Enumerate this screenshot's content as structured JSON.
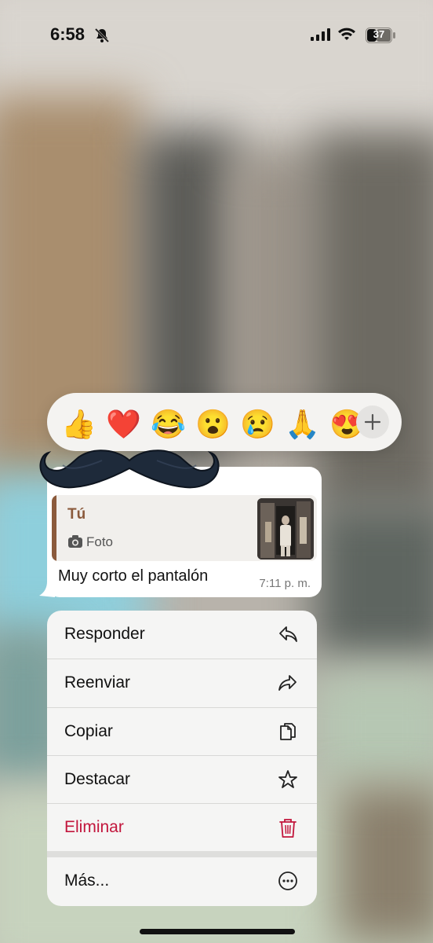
{
  "status_bar": {
    "time": "6:58",
    "battery": "37",
    "icons": [
      "bell-slash-icon",
      "signal-icon",
      "wifi-icon",
      "battery-icon"
    ]
  },
  "reactions": {
    "emojis": [
      "👍",
      "❤️",
      "😂",
      "😮",
      "😢",
      "🙏",
      "😍"
    ],
    "more_icon": "plus-icon"
  },
  "message": {
    "quote": {
      "author": "Tú",
      "kind": "Foto",
      "icon": "camera-icon"
    },
    "text": "Muy corto el pantalón",
    "time": "7:11 p. m."
  },
  "context_menu": {
    "items": [
      {
        "label": "Responder",
        "icon": "reply-icon"
      },
      {
        "label": "Reenviar",
        "icon": "forward-icon"
      },
      {
        "label": "Copiar",
        "icon": "copy-icon"
      },
      {
        "label": "Destacar",
        "icon": "star-icon"
      },
      {
        "label": "Eliminar",
        "icon": "trash-icon",
        "destructive": true
      },
      {
        "label": "Más...",
        "icon": "more-icon"
      }
    ]
  },
  "colors": {
    "quote_accent": "#8b5a3c",
    "destructive": "#c2163c"
  }
}
